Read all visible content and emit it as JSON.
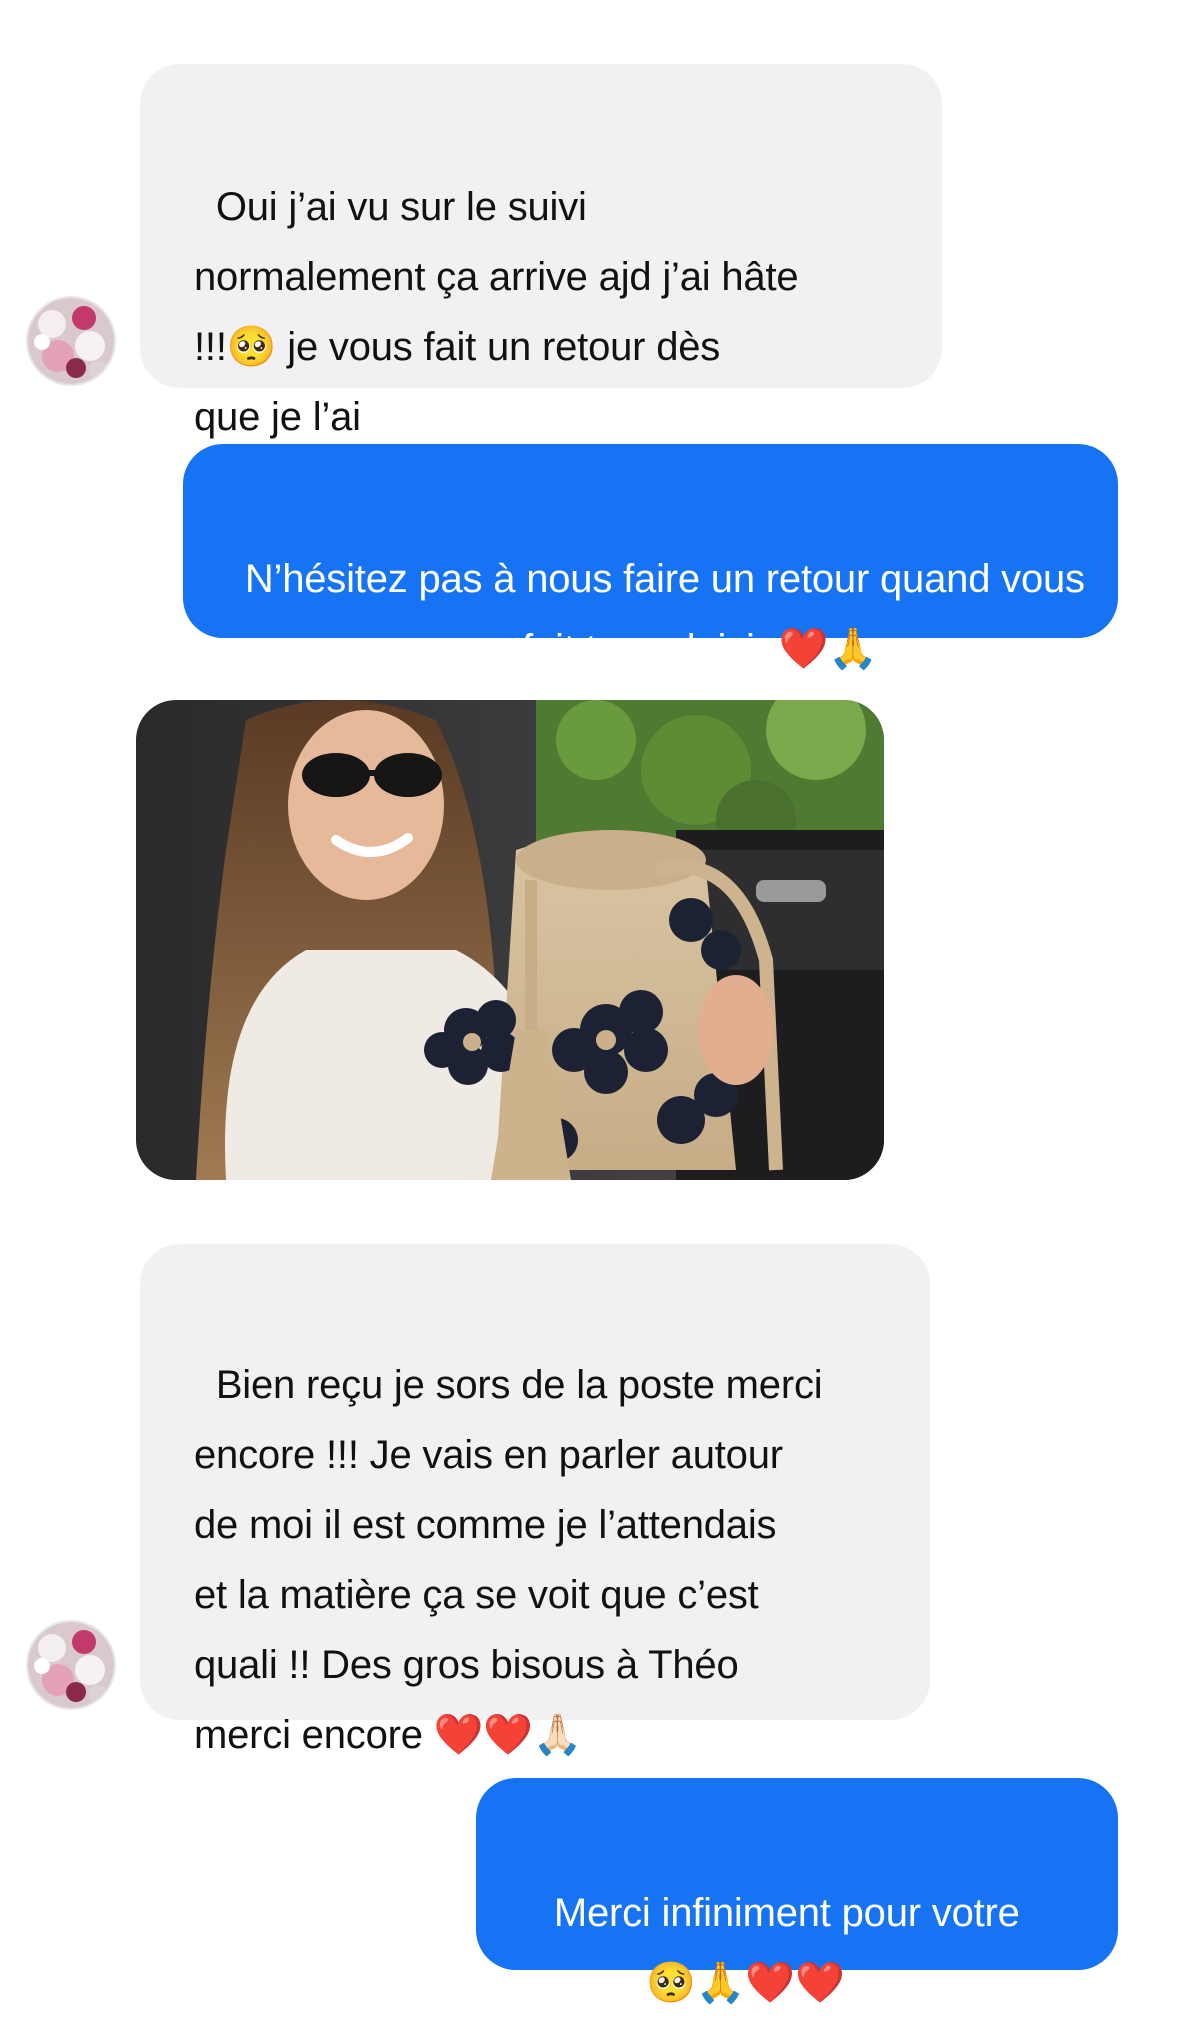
{
  "messages": [
    {
      "direction": "incoming",
      "text": "Oui j’ai vu sur le suivi\nnormalement ça arrive ajd j’ai hâte\n!!!🥺 je vous fait un retour dès\nque je l’ai"
    },
    {
      "direction": "outgoing",
      "text": "N’hésitez pas à nous faire un retour quand vous\nrecevez ça nous fait trop plaisir ❤️🙏"
    },
    {
      "direction": "incoming",
      "type": "photo",
      "subject": "woman in sunglasses holding a crochet bucket bag with dark flowers"
    },
    {
      "direction": "incoming",
      "text": "Bien reçu je sors de la poste merci\nencore !!! Je vais en parler autour\nde moi il est comme je l’attendais\net la matière ça se voit que c’est\nquali !! Des gros bisous à Théo\nmerci encore ❤️❤️🙏🏻"
    },
    {
      "direction": "outgoing",
      "text": "Merci infiniment pour votre\nretour 🥺🙏❤️❤️"
    }
  ],
  "colors": {
    "outgoing_bubble": "#1673f3",
    "incoming_bubble": "#f1f1f3",
    "background": "#ffffff"
  },
  "icons": {
    "avatar": "contact-avatar-flowers"
  }
}
